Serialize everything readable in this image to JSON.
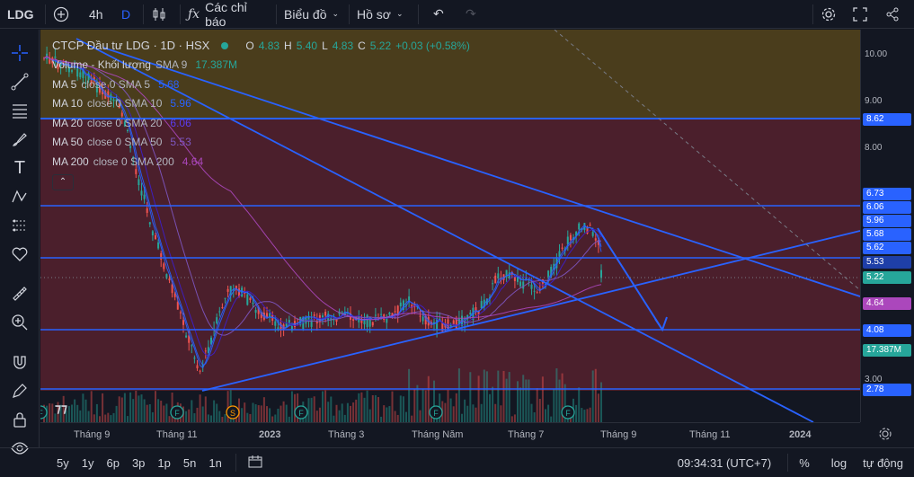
{
  "topbar": {
    "symbol": "LDG",
    "interval": "4h",
    "interval_letter": "D",
    "indicators_label": "Các chỉ báo",
    "chart_label": "Biểu đồ",
    "profile_label": "Hồ sơ"
  },
  "legend": {
    "title": "CTCP Đầu tư LDG · 1D · HSX",
    "ohlc": {
      "o_label": "O",
      "o": "4.83",
      "h_label": "H",
      "h": "5.40",
      "l_label": "L",
      "l": "4.83",
      "c_label": "C",
      "c": "5.22",
      "change": "+0.03 (+0.58%)"
    },
    "indicators": [
      {
        "name": "Volume - Khối lượng",
        "params": "SMA 9",
        "value": "17.387M",
        "color": "#26a69a"
      },
      {
        "name": "MA 5",
        "params": "close 0 SMA 5",
        "value": "5.68",
        "color": "#2962ff"
      },
      {
        "name": "MA 10",
        "params": "close 0 SMA 10",
        "value": "5.96",
        "color": "#2962ff"
      },
      {
        "name": "MA 20",
        "params": "close 0 SMA 20",
        "value": "6.06",
        "color": "#3d1ecc"
      },
      {
        "name": "MA 50",
        "params": "close 0 SMA 50",
        "value": "5.53",
        "color": "#7e57c2"
      },
      {
        "name": "MA 200",
        "params": "close 0 SMA 200",
        "value": "4.64",
        "color": "#ab47bc"
      }
    ]
  },
  "price_axis": {
    "ticks": [
      "10.00",
      "9.00",
      "8.00",
      "3.00"
    ],
    "labels": [
      {
        "text": "8.62",
        "color": "#2962ff"
      },
      {
        "text": "6.73",
        "color": "#2962ff"
      },
      {
        "text": "6.06",
        "color": "#2962ff"
      },
      {
        "text": "5.96",
        "color": "#2962ff"
      },
      {
        "text": "5.68",
        "color": "#2962ff"
      },
      {
        "text": "5.62",
        "color": "#2962ff"
      },
      {
        "text": "5.53",
        "color": "#1e3fa8"
      },
      {
        "text": "5.22",
        "color": "#26a69a"
      },
      {
        "text": "4.64",
        "color": "#ab47bc"
      },
      {
        "text": "4.08",
        "color": "#2962ff"
      },
      {
        "text": "17.387M",
        "color": "#26a69a"
      },
      {
        "text": "2.78",
        "color": "#2962ff"
      }
    ]
  },
  "time_axis": [
    "Tháng 9",
    "Tháng 11",
    "2023",
    "Tháng 3",
    "Tháng Năm",
    "Tháng 7",
    "Tháng 9",
    "Tháng 11",
    "2024"
  ],
  "event_markers": [
    "F",
    "F",
    "S",
    "F",
    "F",
    "F"
  ],
  "bottombar": {
    "ranges": [
      "5y",
      "1y",
      "6p",
      "3p",
      "1p",
      "5n",
      "1n"
    ],
    "time": "09:34:31 (UTC+7)",
    "pct": "%",
    "log": "log",
    "auto": "tự động"
  },
  "colors": {
    "up": "#26a69a",
    "down": "#ef5350",
    "line": "#2962ff",
    "zone_top": "#4a3d1c",
    "zone_main": "#4b1f2c"
  }
}
